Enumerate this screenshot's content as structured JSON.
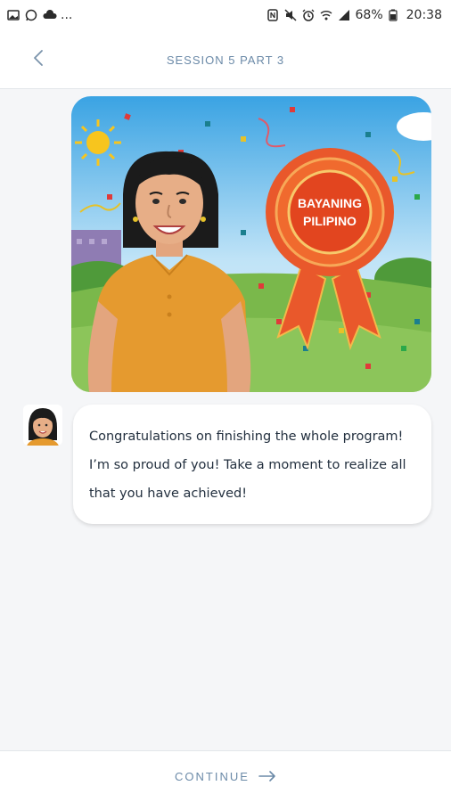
{
  "status_bar": {
    "left_icons": [
      "gallery-icon",
      "whatsapp-icon",
      "cloud-icon"
    ],
    "ellipsis": "...",
    "right_icons": [
      "nfc-icon",
      "mute-icon",
      "alarm-icon",
      "wifi-icon",
      "signal-icon"
    ],
    "battery": "68%",
    "time": "20:38"
  },
  "header": {
    "back_icon": "chevron-left-icon",
    "title": "SESSION 5 PART 3"
  },
  "illustration": {
    "ribbon_line1": "BAYANING",
    "ribbon_line2": "PILIPINO"
  },
  "message": {
    "text": "Congratulations on finishing the whole program! I’m so proud of you! Take a moment to realize all that you have achieved!"
  },
  "footer": {
    "continue_label": "CONTINUE",
    "arrow_icon": "arrow-right-icon"
  },
  "colors": {
    "accent": "#6b8aa8",
    "ribbon": "#e9582b",
    "shirt": "#e59a2f"
  }
}
